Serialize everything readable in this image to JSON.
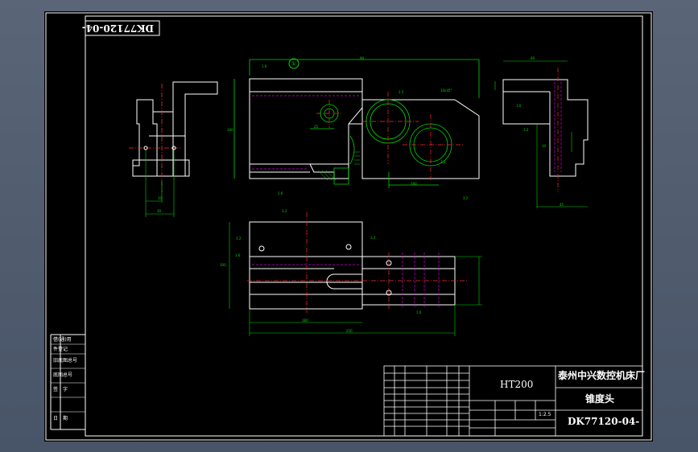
{
  "drawing_number_rotated": "DK77120-04-",
  "title_block": {
    "material": "HT200",
    "company": "泰州中兴数控机床厂",
    "part_name": "锥度头",
    "drawing_number": "DK77120-04-",
    "scale": "1:2.5"
  },
  "side_stamp_labels": [
    "借(通)用",
    "件登记",
    "旧底图总号",
    "底图总号",
    "签　字",
    "日　期"
  ],
  "dimensions": {
    "front_view": [
      "1.6",
      "①",
      "2.5",
      "100",
      "90",
      "25",
      "190",
      "10x45°",
      "3.2",
      "3.2",
      "1.6"
    ],
    "left_view": [
      "10",
      "30"
    ],
    "right_view": [
      "60",
      "1.6",
      "3.2",
      "10",
      "45"
    ],
    "top_view": [
      "3.2",
      "3.2",
      "1.6",
      "3.2",
      "100",
      "180",
      "250",
      "1.6"
    ]
  },
  "colors": {
    "background": "#000000",
    "outline": "#ffffff",
    "dimension": "#00d800",
    "centerline": "#ff2a2a",
    "hidden": "#d400d4"
  }
}
